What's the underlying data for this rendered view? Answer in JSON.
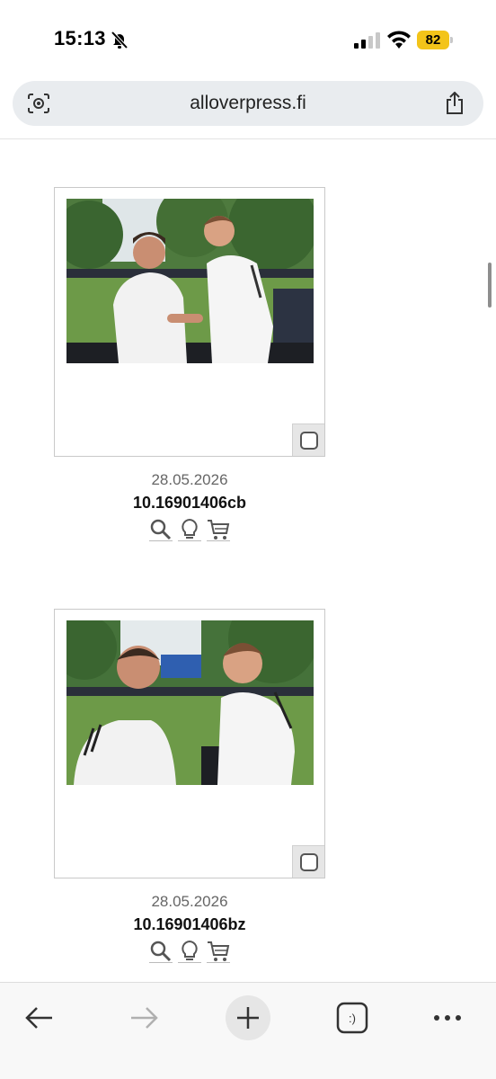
{
  "status_bar": {
    "time": "15:13",
    "battery": "82"
  },
  "address_bar": {
    "url": "alloverpress.fi"
  },
  "results": [
    {
      "date": "28.05.2026",
      "code": "10.16901406cb"
    },
    {
      "date": "28.05.2026",
      "code": "10.16901406bz"
    }
  ],
  "icons": {
    "status": [
      "bell-off-icon",
      "cellular-signal-icon",
      "wifi-icon",
      "battery-icon"
    ],
    "address": [
      "visual-search-icon",
      "share-icon"
    ],
    "item_actions": [
      "magnifier-icon",
      "lightbulb-icon",
      "shopping-cart-icon"
    ],
    "toolbar": [
      "back-arrow-icon",
      "forward-arrow-icon",
      "plus-icon",
      "tabs-icon",
      "more-icon"
    ]
  },
  "tabs_icon_label": ":)",
  "colors": {
    "battery": "#f3c419",
    "address_bar": "#e9ecef",
    "toolbar": "#f8f8f8"
  }
}
